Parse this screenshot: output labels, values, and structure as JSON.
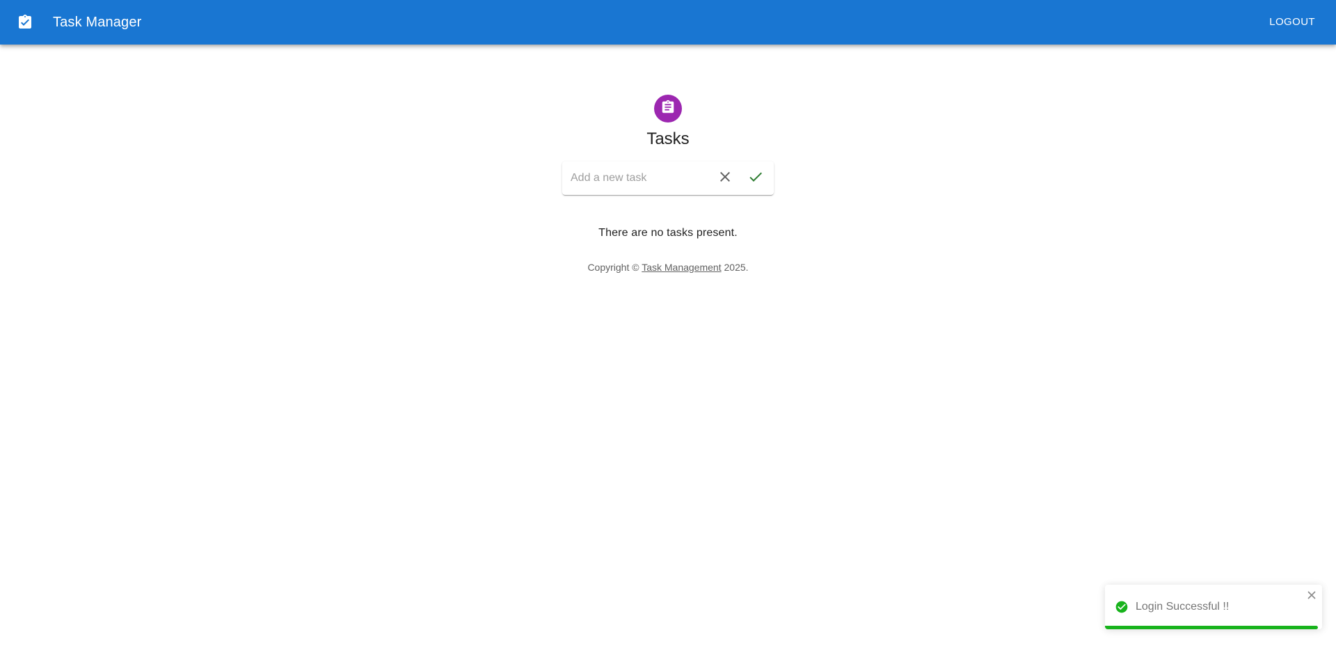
{
  "appbar": {
    "title": "Task Manager",
    "logo_icon": "clipboard-check-icon",
    "logout_label": "LOGOUT",
    "background": "#1976d2"
  },
  "main": {
    "avatar_icon": "assignment-icon",
    "avatar_color": "#9c27b0",
    "title": "Tasks",
    "task_input": {
      "value": "",
      "placeholder": "Add a new task"
    },
    "clear_icon": "close-icon",
    "submit_icon": "check-icon",
    "empty_message": "There are no tasks present.",
    "copyright": {
      "prefix": "Copyright © ",
      "link_text": "Task Management",
      "suffix": " 2025."
    }
  },
  "toast": {
    "message": "Login Successful !!",
    "status_icon": "check-circle-icon",
    "close_icon": "close-icon",
    "accent": "#18b31c",
    "progress": 0.98
  }
}
